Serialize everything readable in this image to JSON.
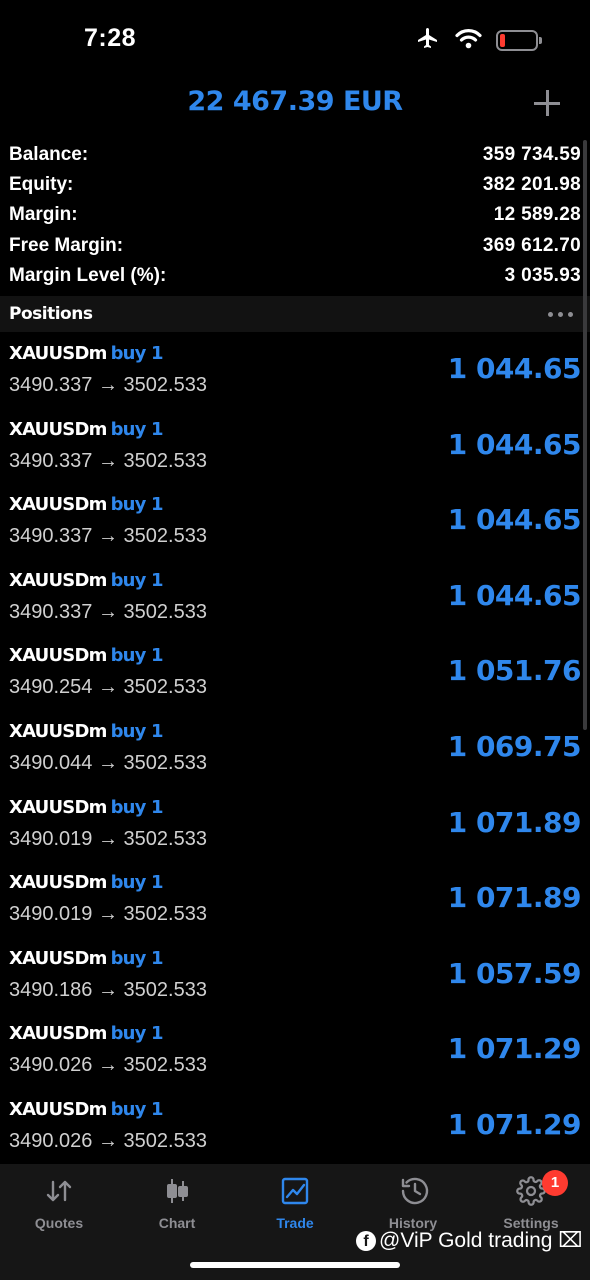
{
  "status_bar": {
    "time": "7:28",
    "icons": [
      "airplane-icon",
      "wifi-icon",
      "battery-icon"
    ]
  },
  "header": {
    "title": "22 467.39 EUR",
    "add_icon": "plus-icon"
  },
  "summary": [
    {
      "label": "Balance:",
      "value": "359 734.59"
    },
    {
      "label": "Equity:",
      "value": "382 201.98"
    },
    {
      "label": "Margin:",
      "value": "12 589.28"
    },
    {
      "label": "Free Margin:",
      "value": "369 612.70"
    },
    {
      "label": "Margin Level (%):",
      "value": "3 035.93"
    }
  ],
  "positions_section": {
    "title": "Positions",
    "menu_icon": "more-dots-icon"
  },
  "positions": [
    {
      "symbol": "XAUUSDm",
      "type": "buy 1",
      "prices": "3490.337 → 3502.533",
      "profit": "1 044.65"
    },
    {
      "symbol": "XAUUSDm",
      "type": "buy 1",
      "prices": "3490.337 → 3502.533",
      "profit": "1 044.65"
    },
    {
      "symbol": "XAUUSDm",
      "type": "buy 1",
      "prices": "3490.337 → 3502.533",
      "profit": "1 044.65"
    },
    {
      "symbol": "XAUUSDm",
      "type": "buy 1",
      "prices": "3490.337 → 3502.533",
      "profit": "1 044.65"
    },
    {
      "symbol": "XAUUSDm",
      "type": "buy 1",
      "prices": "3490.254 → 3502.533",
      "profit": "1 051.76"
    },
    {
      "symbol": "XAUUSDm",
      "type": "buy 1",
      "prices": "3490.044 → 3502.533",
      "profit": "1 069.75"
    },
    {
      "symbol": "XAUUSDm",
      "type": "buy 1",
      "prices": "3490.019 → 3502.533",
      "profit": "1 071.89"
    },
    {
      "symbol": "XAUUSDm",
      "type": "buy 1",
      "prices": "3490.019 → 3502.533",
      "profit": "1 071.89"
    },
    {
      "symbol": "XAUUSDm",
      "type": "buy 1",
      "prices": "3490.186 → 3502.533",
      "profit": "1 057.59"
    },
    {
      "symbol": "XAUUSDm",
      "type": "buy 1",
      "prices": "3490.026 → 3502.533",
      "profit": "1 071.29"
    },
    {
      "symbol": "XAUUSDm",
      "type": "buy 1",
      "prices": "3490.026 → 3502.533",
      "profit": "1 071.29"
    }
  ],
  "tabs": [
    {
      "label": "Quotes",
      "icon": "quotes-arrows-icon",
      "active": false
    },
    {
      "label": "Chart",
      "icon": "candlestick-chart-icon",
      "active": false
    },
    {
      "label": "Trade",
      "icon": "trade-chart-icon",
      "active": true
    },
    {
      "label": "History",
      "icon": "history-clock-icon",
      "active": false
    },
    {
      "label": "Settings",
      "icon": "gear-icon",
      "active": false,
      "badge": "1"
    }
  ],
  "colors": {
    "accent": "#2f87ec",
    "muted": "#8e8e93",
    "badge": "#ff3b30"
  },
  "watermark": {
    "text": "@ViP Gold trading ⌧",
    "icon": "facebook-icon"
  }
}
